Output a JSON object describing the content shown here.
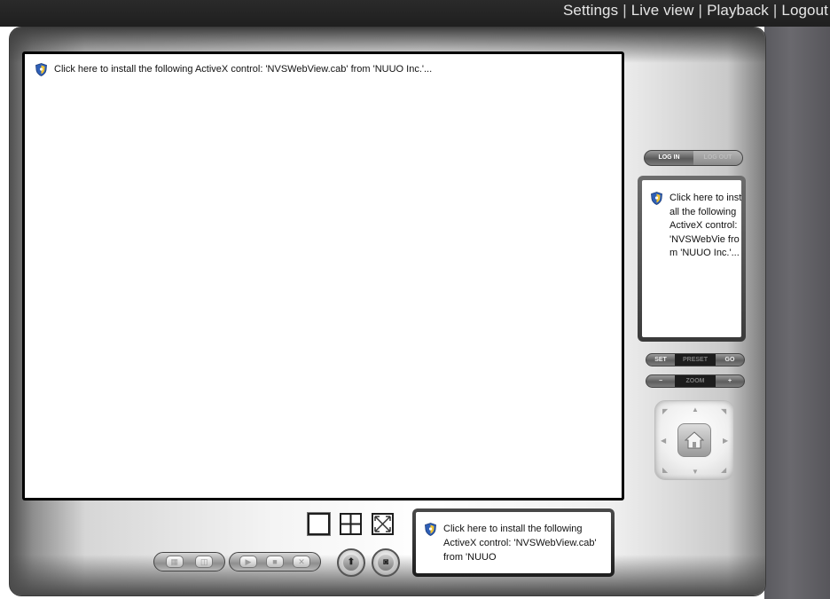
{
  "nav": {
    "items": [
      "Settings",
      "Live view",
      "Playback",
      "Logout"
    ],
    "separator": "|"
  },
  "activex": {
    "main_notice": "Click here to install the following ActiveX control: 'NVSWebView.cab' from 'NUUO Inc.'...",
    "mini_notice": "Click here to install the following ActiveX control: 'NVSWebVie from 'NUUO Inc.'...",
    "status_notice": "Click here to install the following ActiveX control: 'NVSWebView.cab' from 'NUUO"
  },
  "camera_panel": {
    "login_label": "LOG IN",
    "logout_label": "LOG OUT",
    "preset": {
      "set_label": "SET",
      "preset_label": "PRESET",
      "go_label": "GO"
    },
    "zoom": {
      "minus_label": "−",
      "zoom_label": "ZOOM",
      "plus_label": "+"
    },
    "ptz_icon": "home-icon"
  },
  "layout": {
    "options": [
      "single-view",
      "quad-view",
      "fullscreen"
    ]
  },
  "playback_controls": {
    "group1": [
      "1x1",
      "1x4"
    ],
    "group2": [
      "play",
      "stop",
      "close"
    ],
    "snapshot_icon": "camera-icon",
    "save_icon": "save-icon"
  },
  "colors": {
    "top_bar": "#222222",
    "side_strip": "#5f5e63",
    "video_frame": "#000000",
    "accent_shield": "#2f5fb6"
  }
}
